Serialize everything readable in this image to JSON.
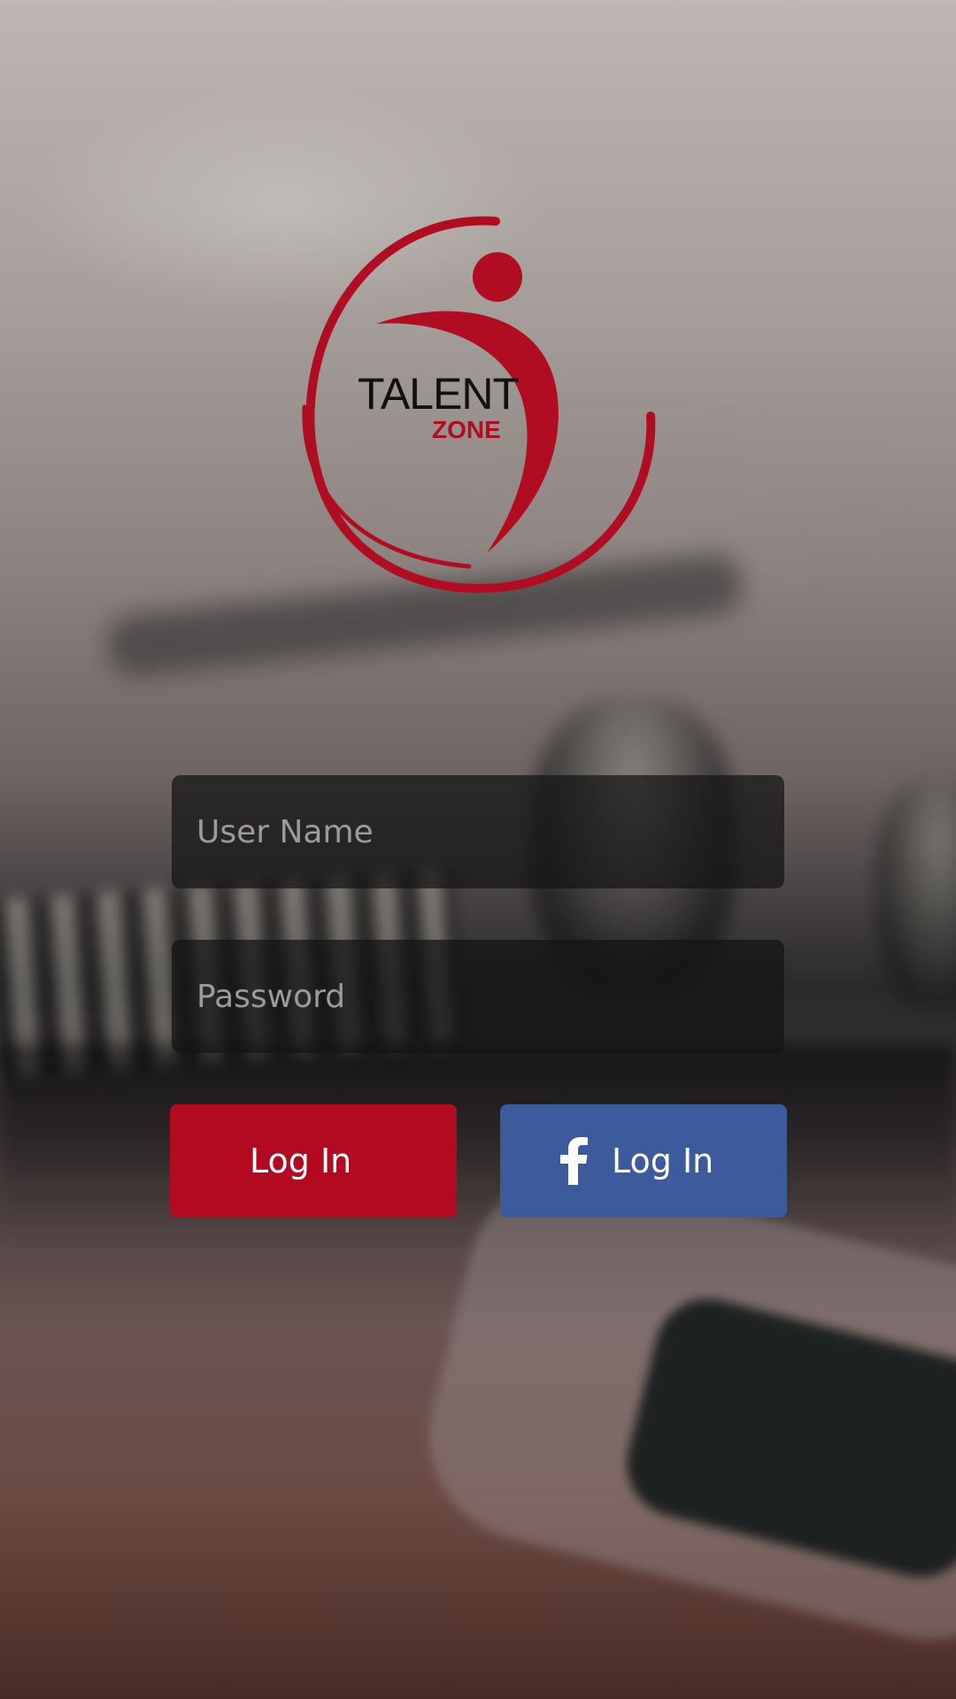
{
  "brand": {
    "name_line1": "TALENT",
    "name_line2": "ZONE",
    "accent_color": "#b00d22"
  },
  "form": {
    "username_placeholder": "User Name",
    "username_value": "",
    "password_placeholder": "Password",
    "password_value": ""
  },
  "buttons": {
    "login_label": "Log In",
    "facebook_login_label": "Log In",
    "login_color": "#b10a21",
    "facebook_color": "#3c5a9c",
    "facebook_icon": "facebook-icon"
  }
}
